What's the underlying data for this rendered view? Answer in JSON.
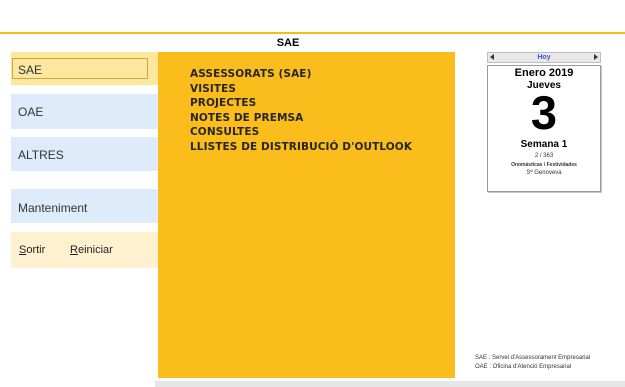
{
  "app": {
    "title": "SAE"
  },
  "sidebar": {
    "items": [
      {
        "label": "SAE"
      },
      {
        "label": "OAE"
      },
      {
        "label": "ALTRES"
      },
      {
        "label": "Manteniment"
      }
    ],
    "actions": {
      "sortir_rest": "ortir",
      "sortir_key": "S",
      "reiniciar_key": "R",
      "reiniciar_rest": "einiciar"
    }
  },
  "main": {
    "menu": [
      "ASSESSORATS (SAE)",
      "VISITES",
      "PROJECTES",
      "NOTES DE PREMSA",
      "CONSULTES",
      "LLISTES DE DISTRIBUCIÓ D'OUTLOOK"
    ]
  },
  "calendar": {
    "today_label": "Hoy",
    "month_year": "Enero 2019",
    "weekday": "Jueves",
    "day": "3",
    "week": "Semana 1",
    "day_of_year": "2 / 363",
    "subtitle": "Onomásticas / Festividades",
    "saint": "Sª Genoveva"
  },
  "legend": {
    "line1": "SAE : Servei d'Assessorament Empresarial",
    "line2": "OAE : Oficina d'Atenció Empresarial"
  },
  "colors": {
    "accent_yellow": "#fbbd1b",
    "nav_blue": "#deebfb",
    "nav_selected": "#fce79f",
    "actions_bg": "#fdf1cf"
  }
}
